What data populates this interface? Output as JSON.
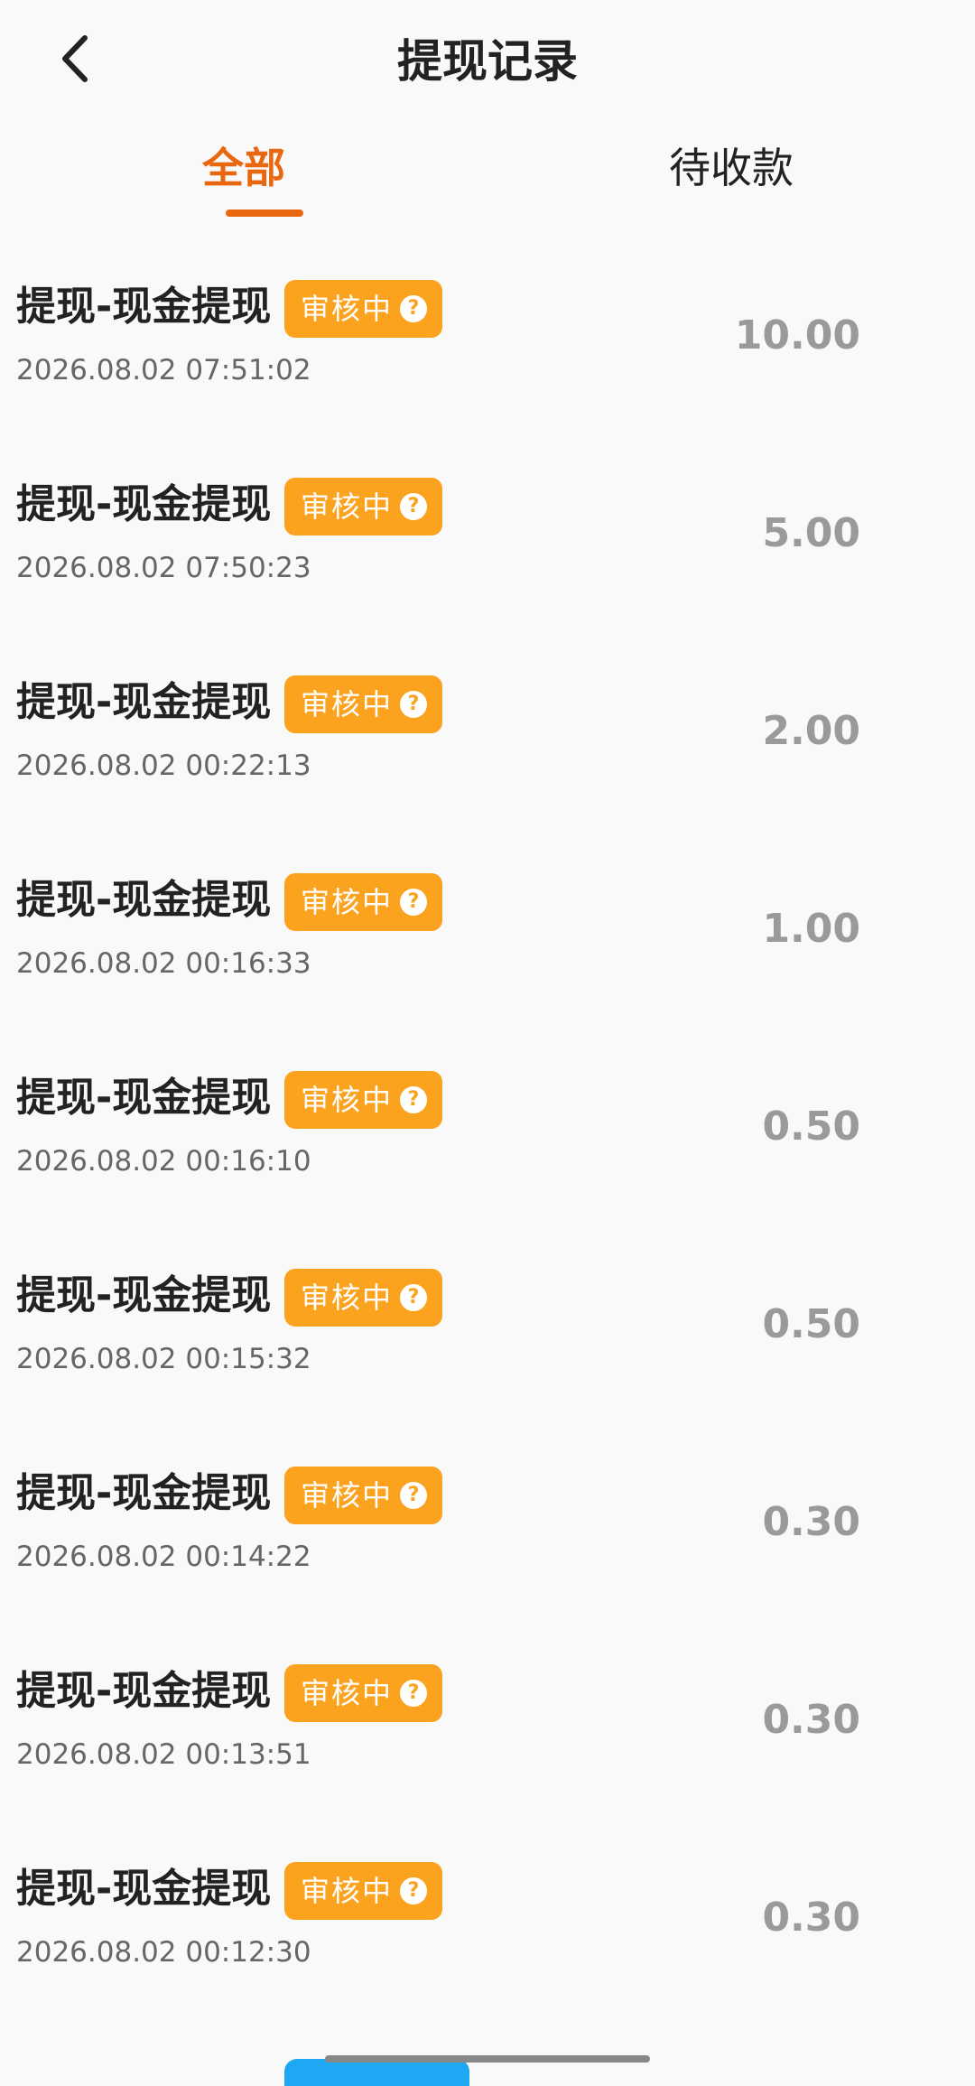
{
  "header": {
    "title": "提现记录"
  },
  "tabs": [
    {
      "label": "全部",
      "active": true
    },
    {
      "label": "待收款",
      "active": false
    }
  ],
  "status_badge_color": "#fba31f",
  "accent_color": "#e8670f",
  "records": [
    {
      "title": "提现-现金提现",
      "status": "审核中",
      "time": "2026.08.02 07:51:02",
      "amount": "10.00"
    },
    {
      "title": "提现-现金提现",
      "status": "审核中",
      "time": "2026.08.02 07:50:23",
      "amount": "5.00"
    },
    {
      "title": "提现-现金提现",
      "status": "审核中",
      "time": "2026.08.02 00:22:13",
      "amount": "2.00"
    },
    {
      "title": "提现-现金提现",
      "status": "审核中",
      "time": "2026.08.02 00:16:33",
      "amount": "1.00"
    },
    {
      "title": "提现-现金提现",
      "status": "审核中",
      "time": "2026.08.02 00:16:10",
      "amount": "0.50"
    },
    {
      "title": "提现-现金提现",
      "status": "审核中",
      "time": "2026.08.02 00:15:32",
      "amount": "0.50"
    },
    {
      "title": "提现-现金提现",
      "status": "审核中",
      "time": "2026.08.02 00:14:22",
      "amount": "0.30"
    },
    {
      "title": "提现-现金提现",
      "status": "审核中",
      "time": "2026.08.02 00:13:51",
      "amount": "0.30"
    },
    {
      "title": "提现-现金提现",
      "status": "审核中",
      "time": "2026.08.02 00:12:30",
      "amount": "0.30"
    }
  ]
}
